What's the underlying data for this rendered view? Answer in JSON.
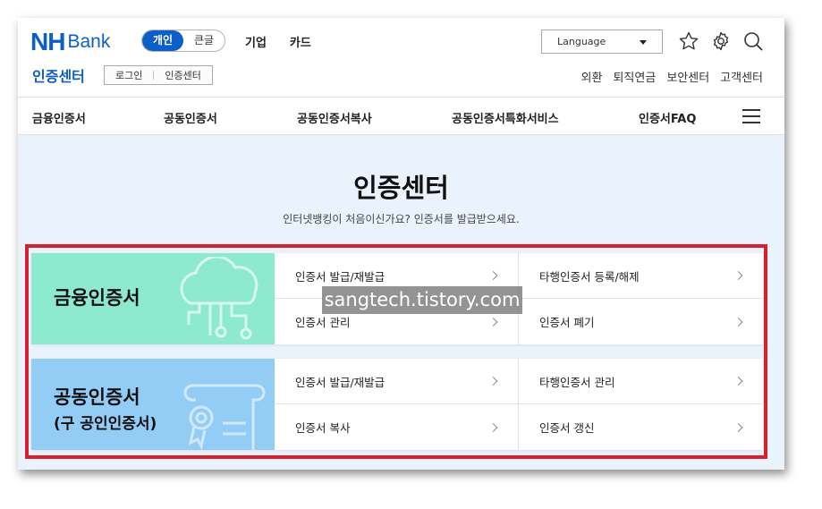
{
  "header": {
    "logo_nh": "NH",
    "logo_bank": "Bank",
    "size_toggle": [
      {
        "label": "개인",
        "active": true
      },
      {
        "label": "큰글",
        "active": false
      }
    ],
    "top_menu": [
      "기업",
      "카드"
    ],
    "center_title": "인증센터",
    "login_box": [
      "로그인",
      "인증센터"
    ],
    "language": "Language",
    "icons": [
      "star-icon",
      "gear-icon",
      "search-icon"
    ],
    "util_menu": [
      "외환",
      "퇴직연금",
      "보안센터",
      "고객센터"
    ]
  },
  "gnb": {
    "items": [
      "금융인증서",
      "공동인증서",
      "공동인증서복사",
      "공동인증서특화서비스",
      "인증서FAQ"
    ]
  },
  "hero": {
    "title": "인증센터",
    "subtitle": "인터넷뱅킹이 처음이신가요? 인증서를 발급받으세요."
  },
  "cards": [
    {
      "title": "금융인증서",
      "subtitle": "",
      "color": "#8deacf",
      "links": [
        "인증서 발급/재발급",
        "타행인증서 등록/해제",
        "인증서 관리",
        "인증서 폐기"
      ]
    },
    {
      "title": "공동인증서",
      "subtitle": "(구 공인인증서)",
      "color": "#93cdf6",
      "links": [
        "인증서 발급/재발급",
        "타행인증서 관리",
        "인증서 복사",
        "인증서 갱신"
      ]
    }
  ],
  "watermark": "sangtech.tistory.com",
  "colors": {
    "brand": "#0b5fc7",
    "highlight": "#d6202e"
  }
}
